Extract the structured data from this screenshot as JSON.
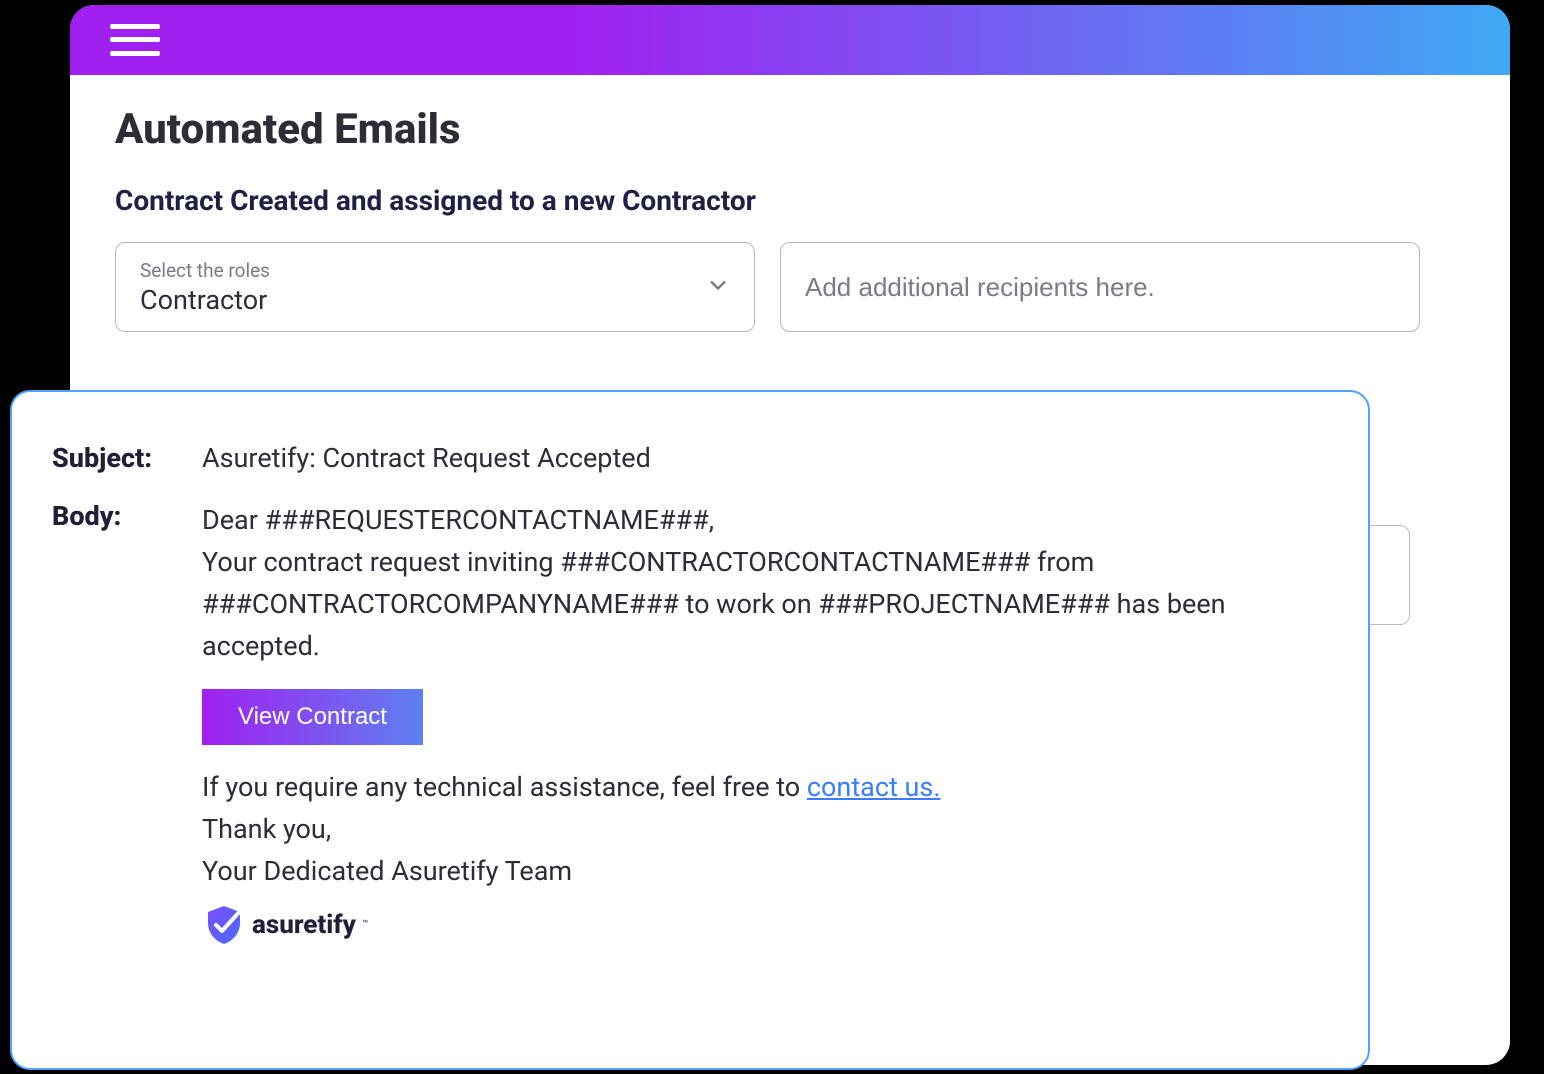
{
  "page": {
    "title": "Automated Emails",
    "section_heading": "Contract Created and assigned to a new Contractor"
  },
  "roles_select": {
    "label": "Select the roles",
    "value": "Contractor"
  },
  "recipients": {
    "placeholder": "Add additional recipients here."
  },
  "preview": {
    "subject_label": "Subject:",
    "body_label": "Body:",
    "subject": "Asuretify: Contract Request Accepted",
    "greeting": "Dear ###REQUESTERCONTACTNAME###,",
    "line1": "Your contract request inviting ###CONTRACTORCONTACTNAME### from ###CONTRACTORCOMPANYNAME### to work on ###PROJECTNAME### has been accepted.",
    "view_contract_label": "View Contract",
    "assistance_prefix": "If you require any technical assistance, feel free to ",
    "contact_us": "contact us.",
    "thank_you": "Thank you,",
    "signature": "Your Dedicated Asuretify Team",
    "logo_text": "asuretify"
  }
}
